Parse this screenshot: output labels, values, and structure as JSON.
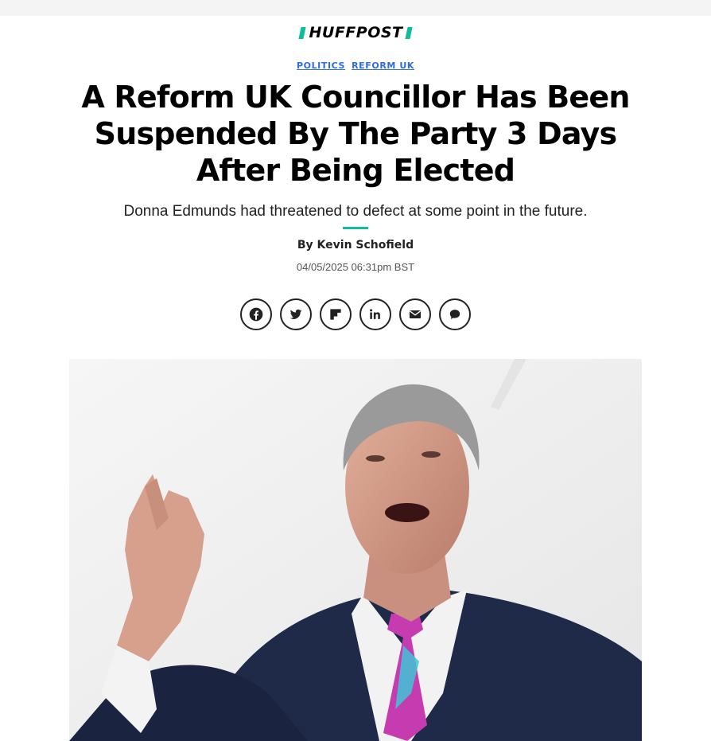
{
  "site": {
    "logo_text": "HUFFPOST"
  },
  "tags": [
    "POLITICS",
    "REFORM UK"
  ],
  "article": {
    "headline": "A Reform UK Councillor Has Been Suspended By The Party 3 Days After Being Elected",
    "dek": "Donna Edmunds had threatened to defect at some point in the future.",
    "byline": "By Kevin Schofield",
    "date": "04/05/2025 06:31pm BST"
  },
  "share": [
    {
      "icon": "facebook-icon"
    },
    {
      "icon": "twitter-icon"
    },
    {
      "icon": "flipboard-icon"
    },
    {
      "icon": "linkedin-icon"
    },
    {
      "icon": "email-icon"
    },
    {
      "icon": "comment-icon"
    }
  ],
  "colors": {
    "accent": "#0dbe98",
    "tag_link": "#2d6be0",
    "topbar": "#f4f4f4"
  }
}
